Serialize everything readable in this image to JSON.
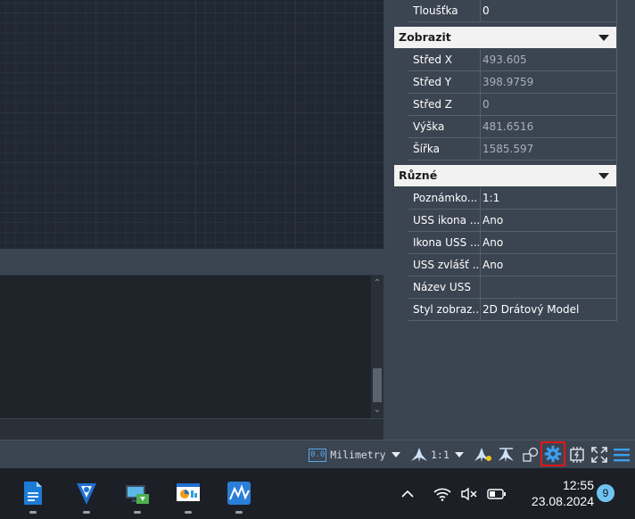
{
  "properties": {
    "top_row": {
      "label": "Tloušťka",
      "value": "0"
    },
    "sections": [
      {
        "title": "Zobrazit",
        "rows": [
          {
            "label": "Střed X",
            "value": "493.605"
          },
          {
            "label": "Střed Y",
            "value": "398.9759"
          },
          {
            "label": "Střed Z",
            "value": "0"
          },
          {
            "label": "Výška",
            "value": "481.6516"
          },
          {
            "label": "Šířka",
            "value": "1585.597"
          }
        ]
      },
      {
        "title": "Různé",
        "rows": [
          {
            "label": "Poznámko...",
            "value": "1:1"
          },
          {
            "label": "USS ikona ...",
            "value": "Ano"
          },
          {
            "label": "Ikona USS ...",
            "value": "Ano"
          },
          {
            "label": "USS zvlášť ...",
            "value": "Ano"
          },
          {
            "label": "Název USS",
            "value": ""
          },
          {
            "label": "Styl zobraz...",
            "value": "2D Drátový Model"
          }
        ]
      }
    ]
  },
  "statusbar": {
    "units_icon_text": "0.0",
    "units": "Milimetry",
    "annotation_scale": "1:1",
    "icons": [
      "units-icon",
      "annotation-scale-icon",
      "annotation-visibility-icon",
      "auto-scale-icon",
      "isolate-objects-icon",
      "workspace-settings-icon",
      "hardware-acceleration-icon",
      "fullscreen-icon",
      "customize-menu-icon"
    ]
  },
  "taskbar": {
    "apps": [
      "libreoffice-writer-icon",
      "vector-app-icon",
      "remote-desktop-icon",
      "dashboard-app-icon",
      "graph-app-icon"
    ],
    "tray_icons": [
      "chevron-up-icon",
      "wifi-icon",
      "muted-speaker-icon",
      "battery-icon"
    ],
    "time": "12:55",
    "date": "23.08.2024",
    "notifications": "9"
  },
  "colors": {
    "canvas_bg": "#212833",
    "panel_bg": "#3b4451",
    "taskbar_bg": "#1c1f25",
    "highlight": "#e01818",
    "accent_blue": "#2d9cdb"
  }
}
